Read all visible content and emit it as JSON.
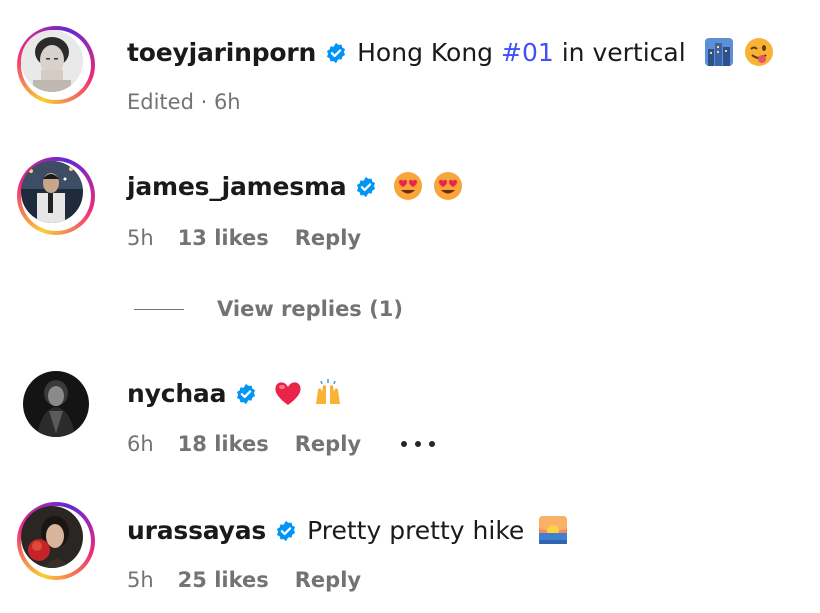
{
  "caption": {
    "username": "toeyjarinporn",
    "text_before": "Hong Kong ",
    "hashtag": "#01",
    "text_after": " in vertical",
    "emojis": [
      "cityscape-emoji",
      "winking-face-tongue-emoji"
    ],
    "meta": "Edited · 6h"
  },
  "comments": [
    {
      "username": "james_jamesma",
      "text": "",
      "emojis": [
        "heart-eyes-emoji",
        "heart-eyes-emoji"
      ],
      "time": "5h",
      "likes": "13 likes",
      "reply": "Reply",
      "view_replies": "View replies (1)"
    },
    {
      "username": "nychaa",
      "text": "",
      "emojis": [
        "red-heart-emoji",
        "raising-hands-emoji"
      ],
      "time": "6h",
      "likes": "18 likes",
      "reply": "Reply",
      "more": "•••"
    },
    {
      "username": "urassayas",
      "text": "Pretty pretty hike",
      "emojis": [
        "sunrise-emoji"
      ],
      "time": "5h",
      "likes": "25 likes",
      "reply": "Reply"
    }
  ],
  "colors": {
    "hashtag": "#4150f7",
    "verified": "#0095f6",
    "meta": "#737373"
  }
}
